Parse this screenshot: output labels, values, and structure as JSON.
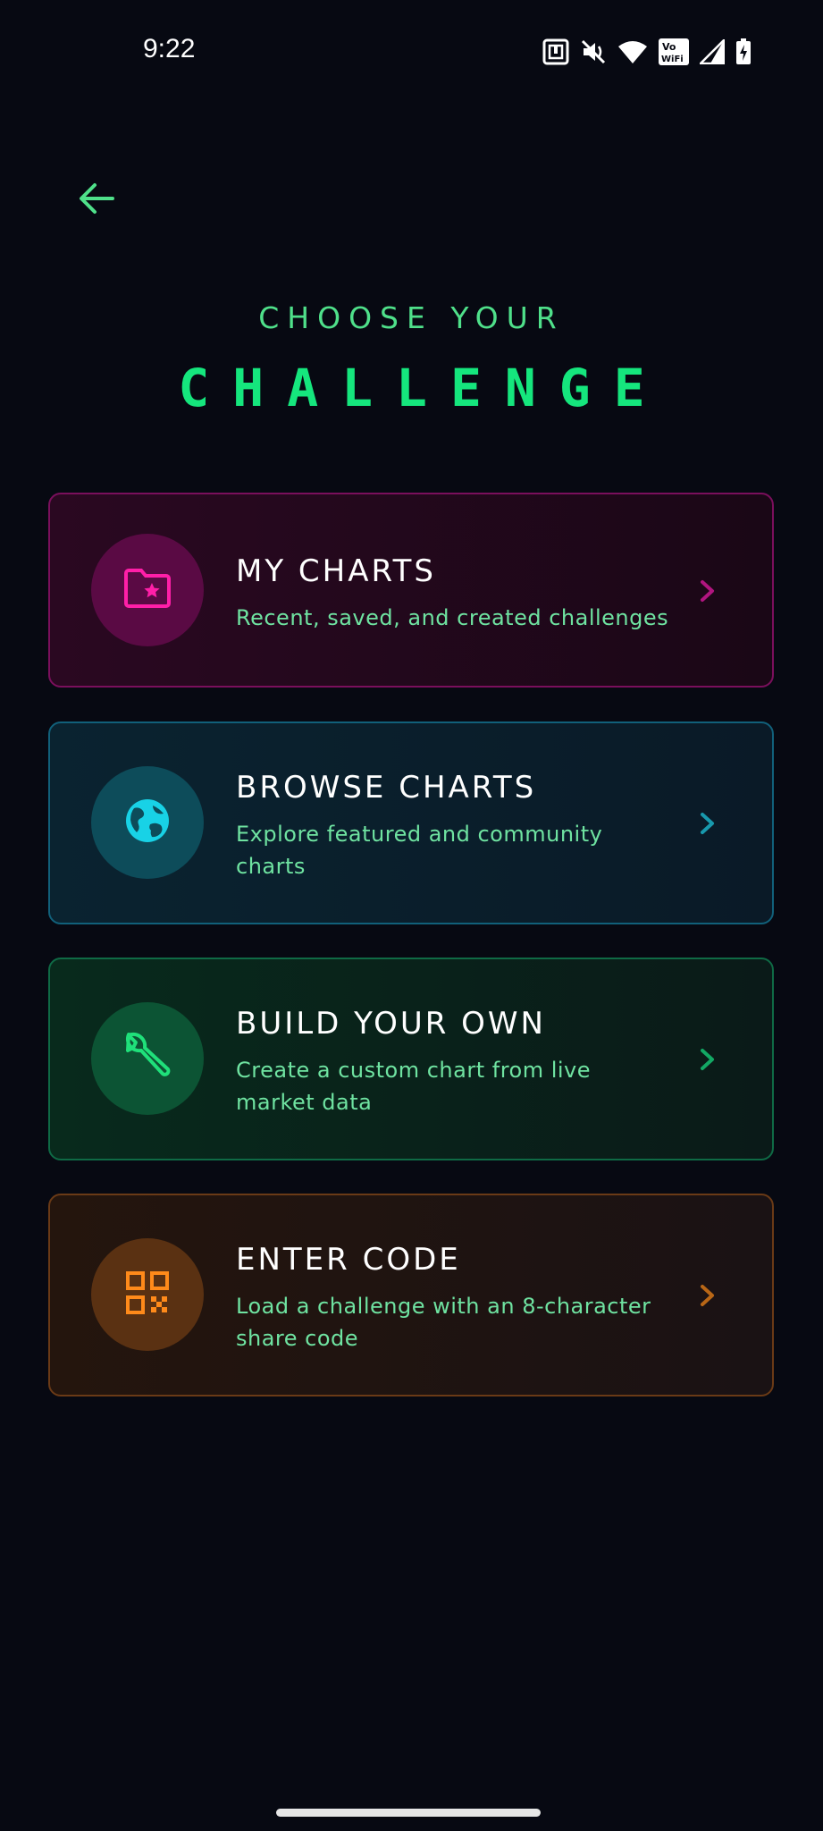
{
  "status_bar": {
    "time": "9:22",
    "icons": [
      "nfc-icon",
      "mute-icon",
      "wifi-icon",
      "vowifi-icon",
      "signal-icon",
      "battery-charging-icon"
    ],
    "vowifi_top": "Vo",
    "vowifi_bottom": "WiFi"
  },
  "header": {
    "back_icon": "arrow-left-icon",
    "title_top": "CHOOSE YOUR",
    "title_main": "CHALLENGE"
  },
  "cards": [
    {
      "id": "my-charts",
      "title": "MY CHARTS",
      "description": "Recent, saved, and created challenges",
      "icon": "folder-star-icon",
      "accent": "#ff1fa8"
    },
    {
      "id": "browse-charts",
      "title": "BROWSE CHARTS",
      "description": "Explore featured and community charts",
      "icon": "globe-icon",
      "accent": "#18d2e6"
    },
    {
      "id": "build-your-own",
      "title": "BUILD YOUR OWN",
      "description": "Create a custom chart from live market data",
      "icon": "wrench-icon",
      "accent": "#1fe07a"
    },
    {
      "id": "enter-code",
      "title": "ENTER CODE",
      "description": "Load a challenge with an 8-character share code",
      "icon": "qr-code-icon",
      "accent": "#ff8a1a"
    }
  ],
  "colors": {
    "background": "#070912",
    "title_green": "#15e67d",
    "subtitle_green": "#6fe3a1"
  }
}
